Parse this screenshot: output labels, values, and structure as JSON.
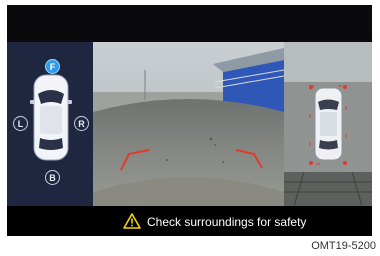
{
  "camera_selector": {
    "front": "F",
    "left": "L",
    "right": "R",
    "back": "B",
    "active": "F"
  },
  "message": {
    "text": "Check surroundings for safety",
    "icon": "warning-triangle-icon",
    "icon_color": "#f2d400"
  },
  "figure_code": "OMT19-5200",
  "colors": {
    "active_badge": "#2f9bea",
    "guide_lines": "#e03a2c",
    "panel": "#1f2640"
  }
}
